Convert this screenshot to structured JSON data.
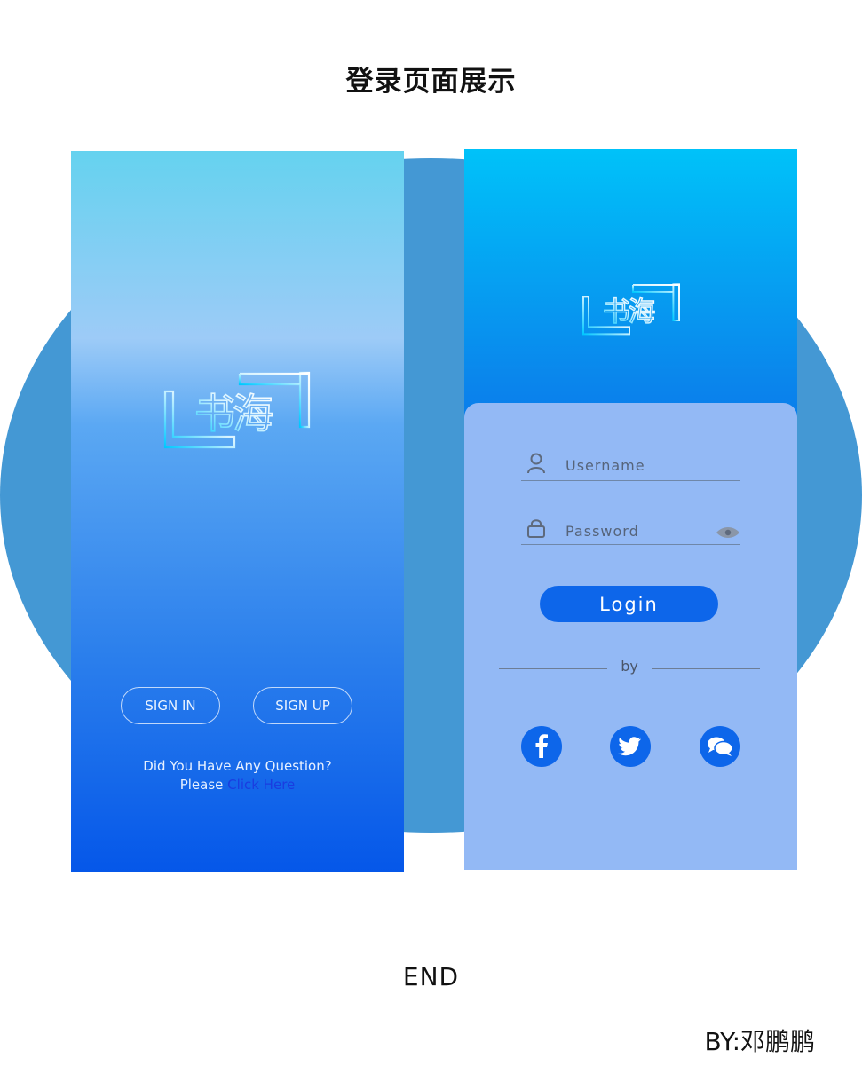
{
  "page": {
    "title": "登录页面展示",
    "end_label": "END",
    "byline": "BY:邓鹏鹏"
  },
  "logo": {
    "text": "书海",
    "icon": "shuhai-logo-icon"
  },
  "welcome_screen": {
    "sign_in_label": "SIGN IN",
    "sign_up_label": "SIGN UP",
    "question_text": "Did You Have Any Question?",
    "please_text": "Please ",
    "link_text": "Click Here"
  },
  "login_screen": {
    "username_placeholder": "Username",
    "password_placeholder": "Password",
    "login_label": "Login",
    "divider_text": "by",
    "social": [
      {
        "name": "facebook",
        "icon": "facebook-icon"
      },
      {
        "name": "twitter",
        "icon": "twitter-icon"
      },
      {
        "name": "message",
        "icon": "message-icon"
      }
    ]
  },
  "colors": {
    "backdrop": "#4498d4",
    "primary_button": "#0d66ea",
    "card": "#93b9f5",
    "link": "#1a3de0"
  }
}
